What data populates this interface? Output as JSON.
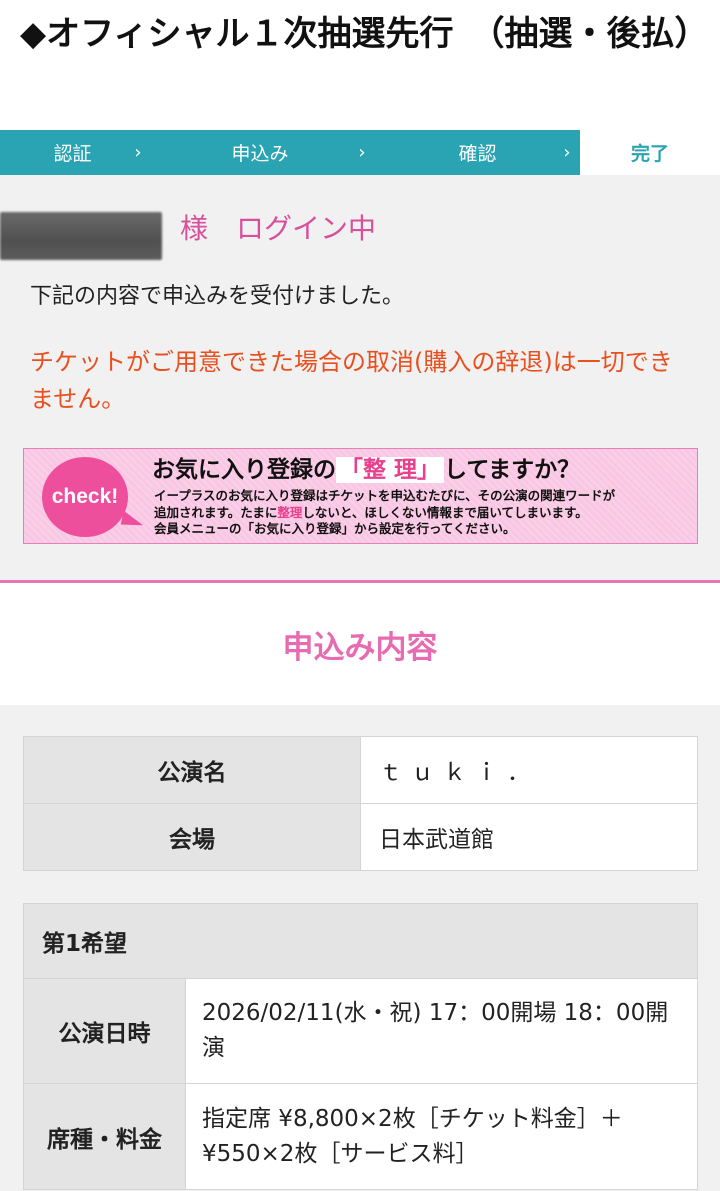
{
  "page": {
    "title": "◆オフィシャル１次抽選先行　（抽選・後払）"
  },
  "steps": [
    {
      "label": "認証",
      "arrow": "›"
    },
    {
      "label": "申込み",
      "arrow": "›"
    },
    {
      "label": "確認",
      "arrow": "›"
    },
    {
      "label": "完了"
    }
  ],
  "login": {
    "text": "様　ログイン中"
  },
  "messages": {
    "received": "下記の内容で申込みを受付けました。",
    "warning": "チケットがご用意できた場合の取消(購入の辞退)は一切できません。"
  },
  "banner": {
    "badge": "check!",
    "title_pre": "お気に入り登録の",
    "title_highlight": "「整 理」",
    "title_post": "してますか？",
    "body_line1": "イープラスのお気に入り登録はチケットを申込むたびに、その公演の関連ワードが",
    "body_line2_pre": "追加されます。たまに",
    "body_line2_pink": "整理",
    "body_line2_post": "しないと、ほしくない情報まで届いてしまいます。",
    "body_line3": "会員メニューの「お気に入り登録」から設定を行ってください。"
  },
  "section": {
    "title": "申込み内容"
  },
  "event_table": {
    "rows": [
      {
        "label": "公演名",
        "value": "ｔｕｋｉ．"
      },
      {
        "label": "会場",
        "value": "日本武道館"
      }
    ]
  },
  "choice": {
    "heading": "第1希望",
    "rows": [
      {
        "label": "公演日時",
        "value": "2026/02/11(水・祝) 17：00開場 18：00開演"
      },
      {
        "label": "席種・料金",
        "value": "指定席 ¥8,800×2枚［チケット料金］＋¥550×2枚［サービス料］"
      }
    ]
  },
  "colors": {
    "teal": "#2aa3b2",
    "pink": "#e76bb0",
    "warning": "#e8501f"
  }
}
